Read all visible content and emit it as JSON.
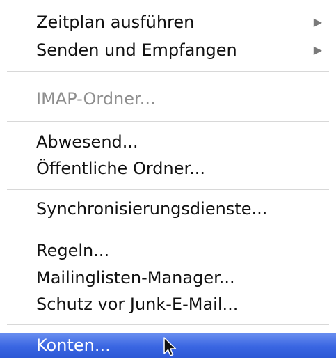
{
  "menu": {
    "items": [
      {
        "label": "Zeitplan ausführen",
        "submenu_glyph": "▶"
      },
      {
        "label": "Senden und Empfangen",
        "submenu_glyph": "▶"
      },
      {
        "label": "IMAP-Ordner..."
      },
      {
        "label": "Abwesend..."
      },
      {
        "label": "Öffentliche Ordner..."
      },
      {
        "label": "Synchronisierungsdienste..."
      },
      {
        "label": "Regeln..."
      },
      {
        "label": "Mailinglisten-Manager..."
      },
      {
        "label": "Schutz vor Junk-E-Mail..."
      },
      {
        "label": "Konten..."
      }
    ]
  },
  "colors": {
    "highlight": "#3a66e2",
    "disabled_text": "#8e8e8e",
    "separator": "#d8d8d8"
  },
  "icons": {
    "submenu": "submenu-arrow-icon",
    "pointer": "mouse-pointer-icon"
  }
}
